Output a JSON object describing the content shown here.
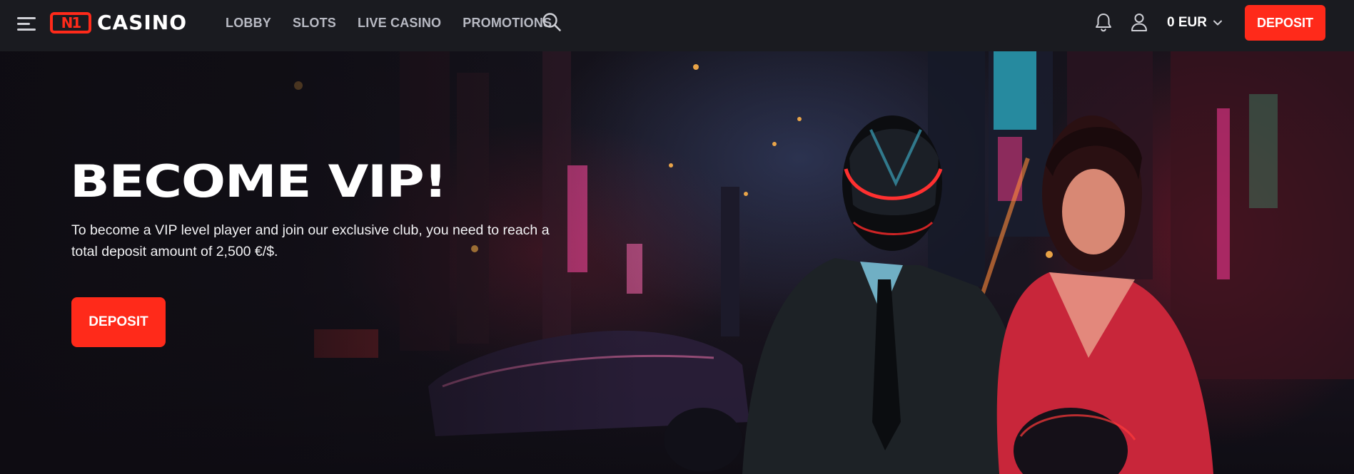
{
  "header": {
    "logo_mark": "N1",
    "logo_word": "CASINO",
    "nav": [
      {
        "label": "LOBBY"
      },
      {
        "label": "SLOTS"
      },
      {
        "label": "LIVE CASINO"
      },
      {
        "label": "PROMOTIONS"
      }
    ],
    "balance": "0 EUR",
    "deposit_label": "DEPOSIT",
    "icons": {
      "menu": "hamburger-menu-icon",
      "search": "search-icon",
      "notifications": "bell-icon",
      "account": "user-icon",
      "balance_dropdown": "chevron-down-icon"
    }
  },
  "hero": {
    "title": "BECOME VIP!",
    "description": "To become a VIP level player and join our exclusive club, you need to reach a total deposit amount of 2,500 €/$.",
    "cta_label": "DEPOSIT"
  },
  "colors": {
    "accent": "#ff2a1a",
    "header_bg": "#1a1b20",
    "nav_text": "#b8bac3",
    "text": "#ffffff"
  }
}
